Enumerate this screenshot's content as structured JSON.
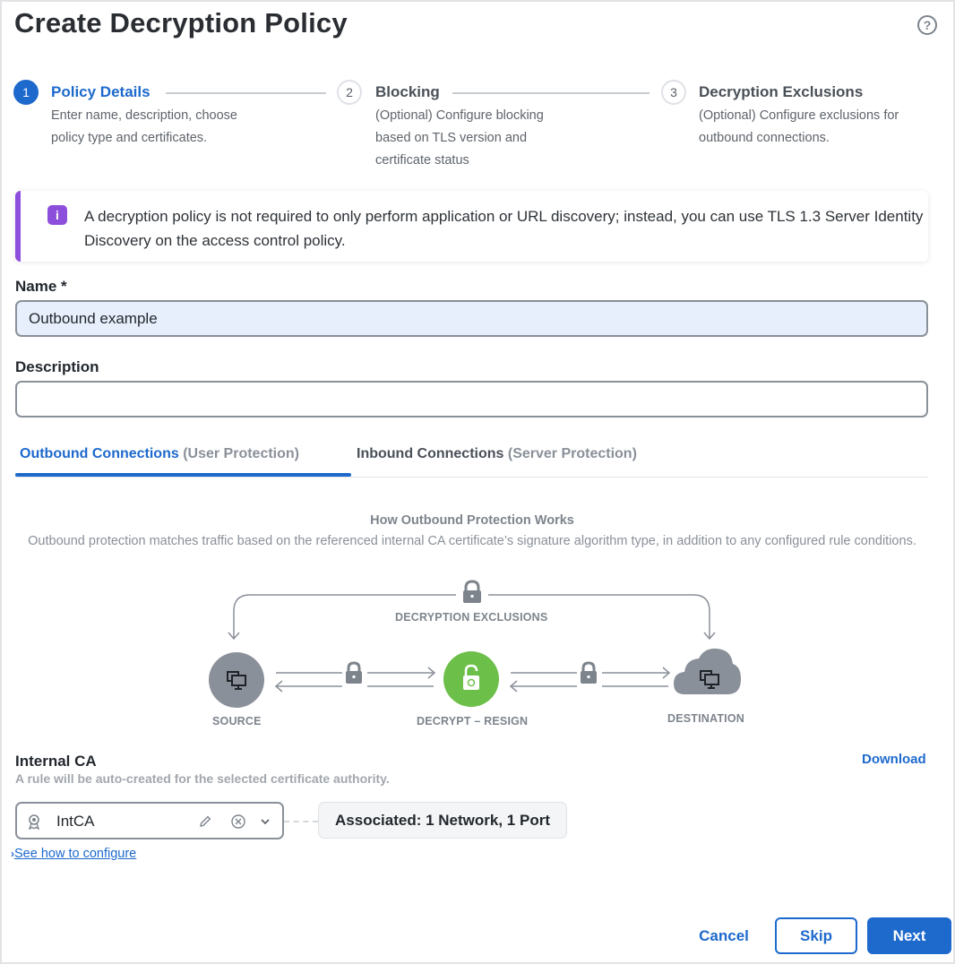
{
  "header": {
    "title": "Create Decryption Policy",
    "help_icon": "question-circle-icon"
  },
  "steps": [
    {
      "number": "1",
      "title": "Policy Details",
      "description_lines": [
        "Enter name, description, choose",
        "policy type and certificates."
      ],
      "state": "active"
    },
    {
      "number": "2",
      "title": "Blocking",
      "description_lines": [
        "(Optional) Configure blocking",
        "based on TLS version and",
        "certificate status"
      ],
      "state": "inactive"
    },
    {
      "number": "3",
      "title": "Decryption Exclusions",
      "description_lines": [
        "(Optional) Configure exclusions for",
        "outbound connections."
      ],
      "state": "inactive"
    }
  ],
  "alert": {
    "icon": "info-icon",
    "text": "A decryption policy is not required to only perform application or URL discovery; instead, you can use TLS 1.3 Server Identity Discovery on the access control policy.",
    "accent_color": "#8c4fdb"
  },
  "form": {
    "name_label": "Name *",
    "name_value": "Outbound example",
    "description_label": "Description",
    "description_value": ""
  },
  "tabs": [
    {
      "main": "Outbound Connections",
      "sub": " (User Protection)",
      "active": true
    },
    {
      "main": "Inbound Connections",
      "sub": " (Server Protection)",
      "active": false
    }
  ],
  "how_it_works": {
    "title": "How Outbound Protection Works",
    "description": "Outbound protection matches traffic based on the referenced internal CA certificate’s signature algorithm type, in addition to any configured rule conditions.",
    "exclusions_label": "DECRYPTION EXCLUSIONS",
    "source_label": "SOURCE",
    "decrypt_label": "DECRYPT – RESIGN",
    "destination_label": "DESTINATION"
  },
  "internal_ca": {
    "title": "Internal CA",
    "subtitle": "A rule will be auto-created for the selected certificate authority.",
    "download_label": "Download",
    "selected_value": "IntCA",
    "associated_text": "Associated: 1 Network, 1 Port",
    "see_how_label": "See how to configure"
  },
  "footer": {
    "cancel_label": "Cancel",
    "skip_label": "Skip",
    "next_label": "Next"
  },
  "colors": {
    "primary": "#1d69cc",
    "success": "#6cc04a",
    "neutral_icon": "#7d848c"
  }
}
